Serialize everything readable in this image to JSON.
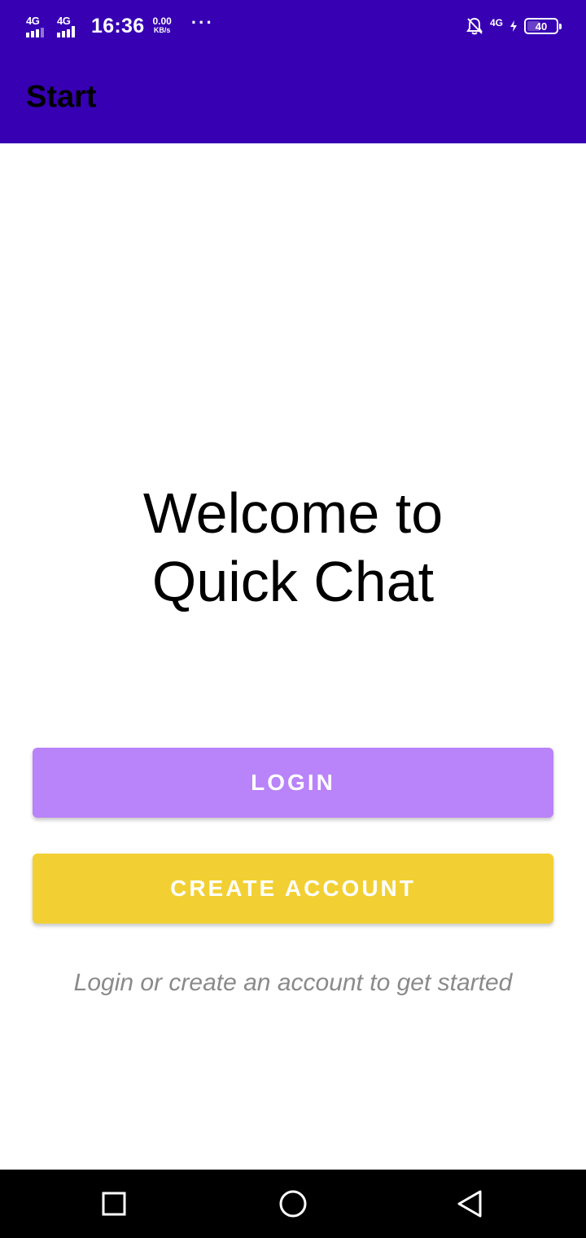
{
  "status_bar": {
    "sim1_network": "4G",
    "sim2_network": "4G",
    "time": "16:36",
    "speed_value": "0.00",
    "speed_unit": "KB/s",
    "more": "···",
    "right_network": "4G",
    "battery_level": "40",
    "icons": [
      "signal-icon",
      "signal-icon",
      "notifications-off-icon",
      "charging-bolt-icon",
      "battery-icon"
    ]
  },
  "app_bar": {
    "title": "Start",
    "color": "#3700b3"
  },
  "main": {
    "welcome_line1": "Welcome to",
    "welcome_line2": "Quick Chat",
    "login_label": "LOGIN",
    "login_color": "#b983fa",
    "create_account_label": "CREATE ACCOUNT",
    "create_account_color": "#f2d034",
    "hint": "Login or create an account to get started"
  },
  "nav_bar": {
    "icons": [
      "recent-apps-icon",
      "home-icon",
      "back-icon"
    ]
  }
}
